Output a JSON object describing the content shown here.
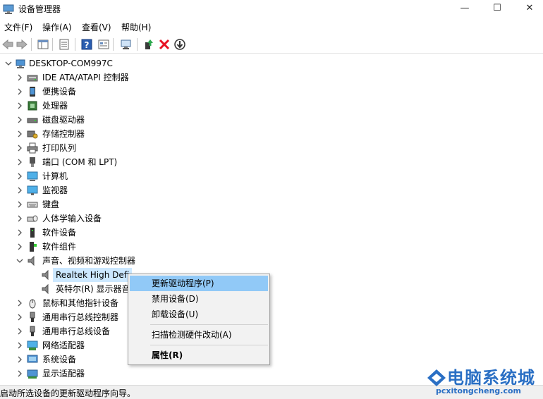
{
  "window": {
    "title": "设备管理器",
    "minimize_glyph": "—",
    "maximize_glyph": "☐",
    "close_glyph": "✕"
  },
  "menu": [
    "文件(F)",
    "操作(A)",
    "查看(V)",
    "帮助(H)"
  ],
  "tree": {
    "root": "DESKTOP-COM997C",
    "categories": [
      {
        "label": "IDE ATA/ATAPI 控制器",
        "icon": "ide-controller-icon"
      },
      {
        "label": "便携设备",
        "icon": "portable-device-icon"
      },
      {
        "label": "处理器",
        "icon": "processor-icon"
      },
      {
        "label": "磁盘驱动器",
        "icon": "disk-drive-icon"
      },
      {
        "label": "存储控制器",
        "icon": "storage-controller-icon"
      },
      {
        "label": "打印队列",
        "icon": "printer-icon"
      },
      {
        "label": "端口 (COM 和 LPT)",
        "icon": "port-icon"
      },
      {
        "label": "计算机",
        "icon": "computer-icon"
      },
      {
        "label": "监视器",
        "icon": "monitor-icon"
      },
      {
        "label": "键盘",
        "icon": "keyboard-icon"
      },
      {
        "label": "人体学输入设备",
        "icon": "hid-icon"
      },
      {
        "label": "软件设备",
        "icon": "software-device-icon"
      },
      {
        "label": "软件组件",
        "icon": "software-component-icon"
      },
      {
        "label": "声音、视频和游戏控制器",
        "icon": "speaker-icon",
        "expanded": true
      }
    ],
    "audio_children": [
      {
        "label": "Realtek High Defi",
        "selected": true
      },
      {
        "label": "英特尔(R) 显示器音"
      }
    ],
    "categories_after": [
      {
        "label": "鼠标和其他指针设备",
        "icon": "mouse-icon"
      },
      {
        "label": "通用串行总线控制器",
        "icon": "usb-icon"
      },
      {
        "label": "通用串行总线设备",
        "icon": "usb-icon"
      },
      {
        "label": "网络适配器",
        "icon": "network-adapter-icon"
      },
      {
        "label": "系统设备",
        "icon": "system-device-icon"
      },
      {
        "label": "显示适配器",
        "icon": "display-adapter-icon"
      }
    ]
  },
  "context_menu": {
    "update_driver": "更新驱动程序(P)",
    "disable_device": "禁用设备(D)",
    "uninstall_device": "卸载设备(U)",
    "scan_hardware": "扫描检测硬件改动(A)",
    "properties": "属性(R)"
  },
  "status": "启动所选设备的更新驱动程序向导。",
  "watermark": {
    "title": "电脑系统城",
    "url": "pcxitongcheng.com"
  },
  "colors": {
    "selection": "#cce8ff",
    "menu_hover": "#91c9f7",
    "watermark": "#2a6fc4",
    "delete_red": "#e81123"
  }
}
